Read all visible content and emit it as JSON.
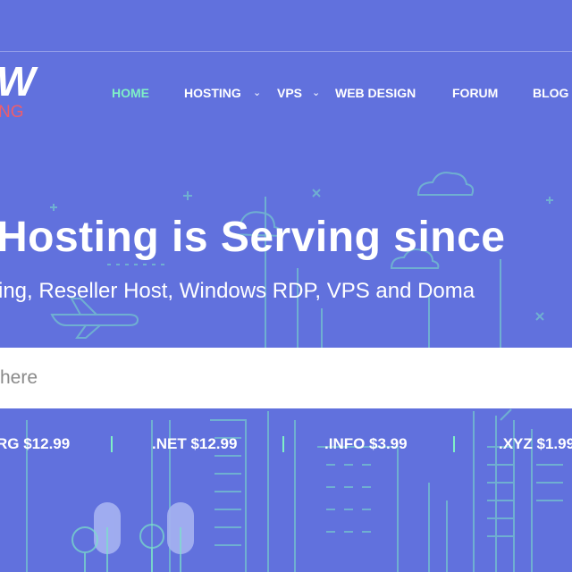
{
  "logo": {
    "mark": "W",
    "sub": "NG"
  },
  "nav": {
    "items": [
      {
        "label": "HOME",
        "active": true
      },
      {
        "label": "HOSTING",
        "has_dropdown": true
      },
      {
        "label": "VPS",
        "has_dropdown": true
      },
      {
        "label": "WEB DESIGN"
      },
      {
        "label": "FORUM"
      },
      {
        "label": "BLOG"
      }
    ]
  },
  "hero": {
    "headline": "Hosting is Serving since",
    "subline": "ing, Reseller Host, Windows RDP, VPS and Doma"
  },
  "search": {
    "placeholder": "here"
  },
  "prices": [
    {
      "label": "RG $12.99"
    },
    {
      "label": ".NET $12.99"
    },
    {
      "label": ".INFO $3.99"
    },
    {
      "label": ".XYZ $1.99"
    }
  ],
  "colors": {
    "background": "#6171dd",
    "accent": "#7ff0c6",
    "logo_sub": "#ef5d6a"
  },
  "icons": [
    "chevron-down-icon",
    "airplane-icon",
    "cloud-icon",
    "tree-icon",
    "building-icon"
  ]
}
